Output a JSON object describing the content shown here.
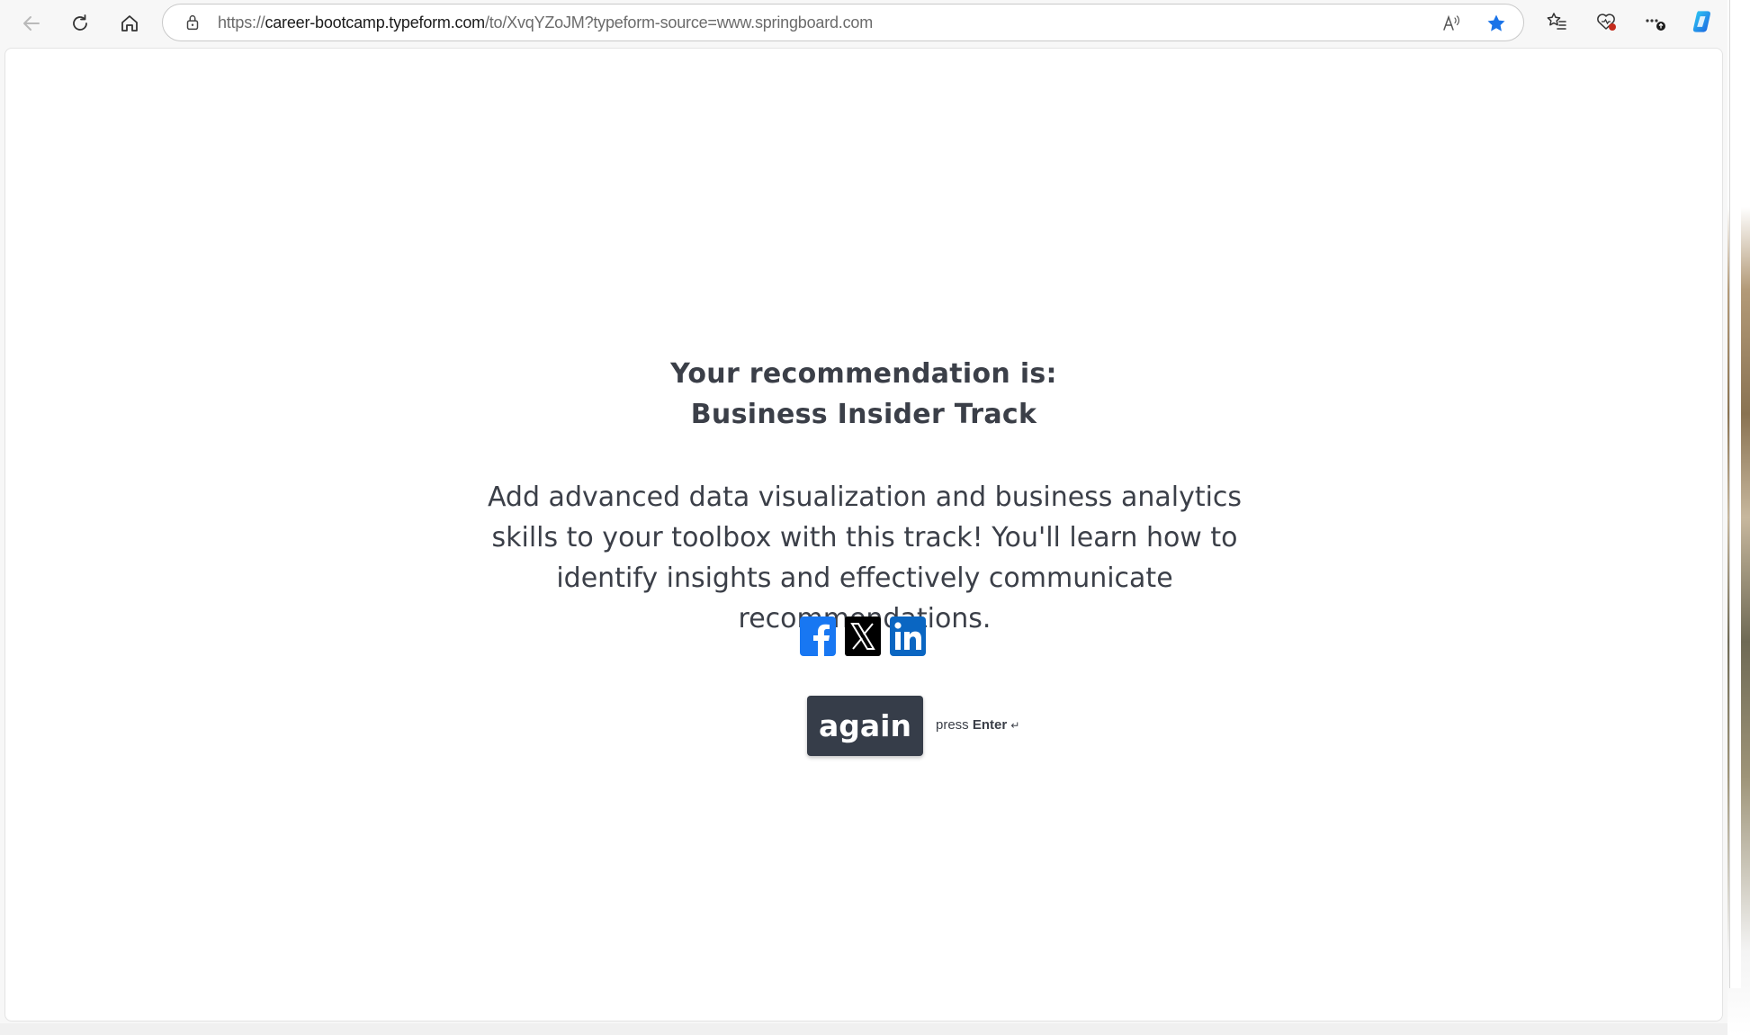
{
  "browser": {
    "url_scheme": "https://",
    "url_host": "career-bootcamp.typeform.com",
    "url_rest": "/to/XvqYZoJM?typeform-source=www.springboard.com",
    "icons": [
      "back-arrow-icon",
      "reload-icon",
      "home-icon",
      "lock-icon",
      "read-aloud-icon",
      "favorite-star-icon",
      "favorites-icon",
      "browser-essentials-icon",
      "more-icon",
      "copilot-icon"
    ],
    "accent_color": "#1a73e8"
  },
  "result": {
    "line1": "Your recommendation is:",
    "line2": "Business Insider Track",
    "description": "Add advanced data visualization and business analytics skills to your toolbox with this track! You'll learn how to identify insights and effectively communicate recommendations.",
    "share_icons": [
      "facebook-icon",
      "x-twitter-icon",
      "linkedin-icon"
    ],
    "again_label": "again",
    "hint_prefix": "press",
    "hint_key": "Enter",
    "hint_symbol": "↵"
  }
}
